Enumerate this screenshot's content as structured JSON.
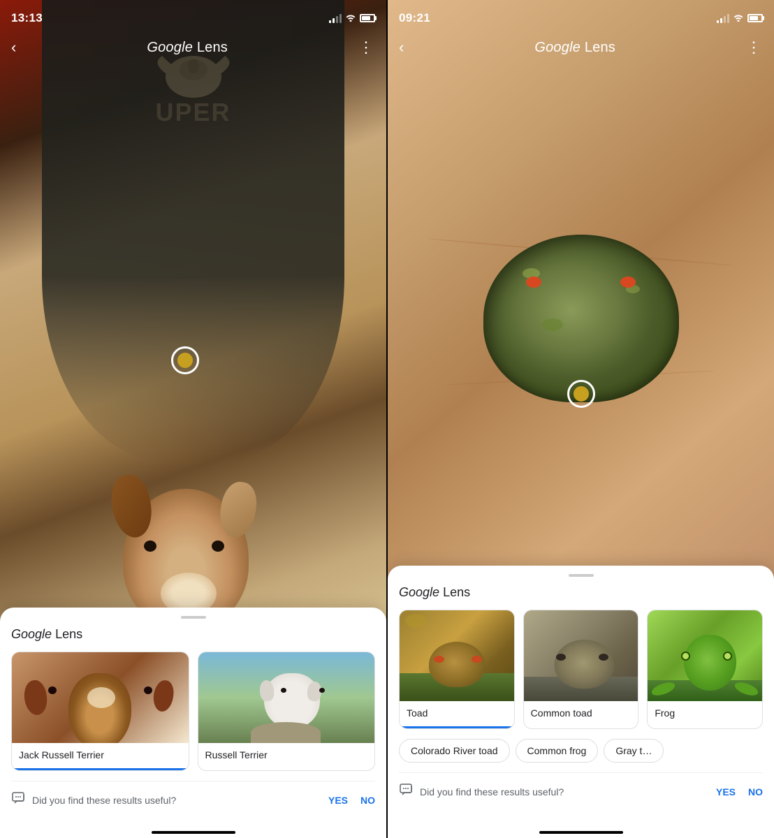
{
  "left_phone": {
    "status": {
      "time": "13:13",
      "battery_level": "80"
    },
    "nav": {
      "back_label": "‹",
      "title_google": "Google",
      "title_lens": "Lens",
      "more_label": "⋮"
    },
    "sheet": {
      "title_google": "Google",
      "title_lens": "Lens",
      "results": [
        {
          "label": "Jack Russell Terrier",
          "selected": true
        },
        {
          "label": "Russell Terrier",
          "selected": false
        }
      ],
      "feedback_text": "Did you find these results useful?",
      "yes_label": "YES",
      "no_label": "NO"
    }
  },
  "right_phone": {
    "status": {
      "time": "09:21",
      "battery_level": "80"
    },
    "nav": {
      "back_label": "‹",
      "title_google": "Google",
      "title_lens": "Lens",
      "more_label": "⋮"
    },
    "sheet": {
      "title_google": "Google",
      "title_lens": "Lens",
      "results": [
        {
          "label": "Toad",
          "selected": true
        },
        {
          "label": "Common toad",
          "selected": false
        },
        {
          "label": "Frog",
          "selected": false
        }
      ],
      "chips": [
        "Colorado River toad",
        "Common frog",
        "Gray t…"
      ],
      "feedback_text": "Did you find these results useful?",
      "yes_label": "YES",
      "no_label": "NO"
    }
  }
}
